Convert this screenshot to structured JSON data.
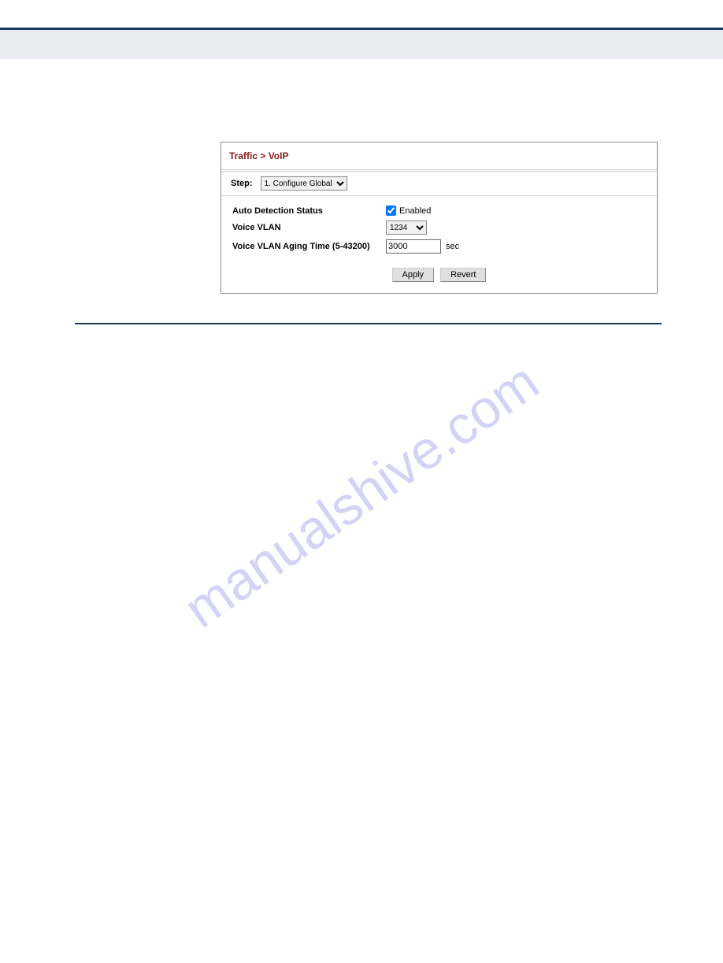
{
  "panel": {
    "title": "Traffic > VoIP",
    "step_label": "Step:",
    "step_value": "1. Configure Global",
    "auto_detection_label": "Auto Detection Status",
    "enabled_label": "Enabled",
    "enabled_checked": true,
    "voice_vlan_label": "Voice VLAN",
    "voice_vlan_value": "1234",
    "aging_time_label": "Voice VLAN Aging Time (5-43200)",
    "aging_time_value": "3000",
    "aging_time_unit": "sec",
    "apply_label": "Apply",
    "revert_label": "Revert"
  },
  "watermark": "manualshive.com"
}
